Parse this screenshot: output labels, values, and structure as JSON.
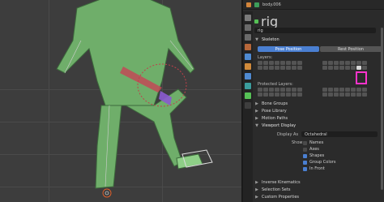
{
  "outliner": {
    "object_name": "body.006"
  },
  "header": {
    "object_name": "rig",
    "data_name": "rig"
  },
  "sections": {
    "skeleton": "Skeleton",
    "layers": "Layers:",
    "protected_layers": "Protected Layers:",
    "bone_groups": "Bone Groups",
    "pose_library": "Pose Library",
    "motion_paths": "Motion Paths",
    "viewport_display": "Viewport Display",
    "inverse_kinematics": "Inverse Kinematics",
    "selection_sets": "Selection Sets",
    "custom_properties": "Custom Properties"
  },
  "pose_buttons": {
    "pose": "Pose Position",
    "rest": "Rest Position"
  },
  "viewport_display": {
    "display_as_label": "Display As",
    "display_as_value": "Octahedral",
    "show_label": "Show",
    "options": [
      {
        "label": "Names",
        "checked": false
      },
      {
        "label": "Axes",
        "checked": false
      },
      {
        "label": "Shapes",
        "checked": true
      },
      {
        "label": "Group Colors",
        "checked": true
      },
      {
        "label": "In Front",
        "checked": true
      }
    ]
  },
  "colors": {
    "accent_blue": "#4a7fd1",
    "highlight": "#ff33cc",
    "panel_bg": "#2b2b2b"
  }
}
